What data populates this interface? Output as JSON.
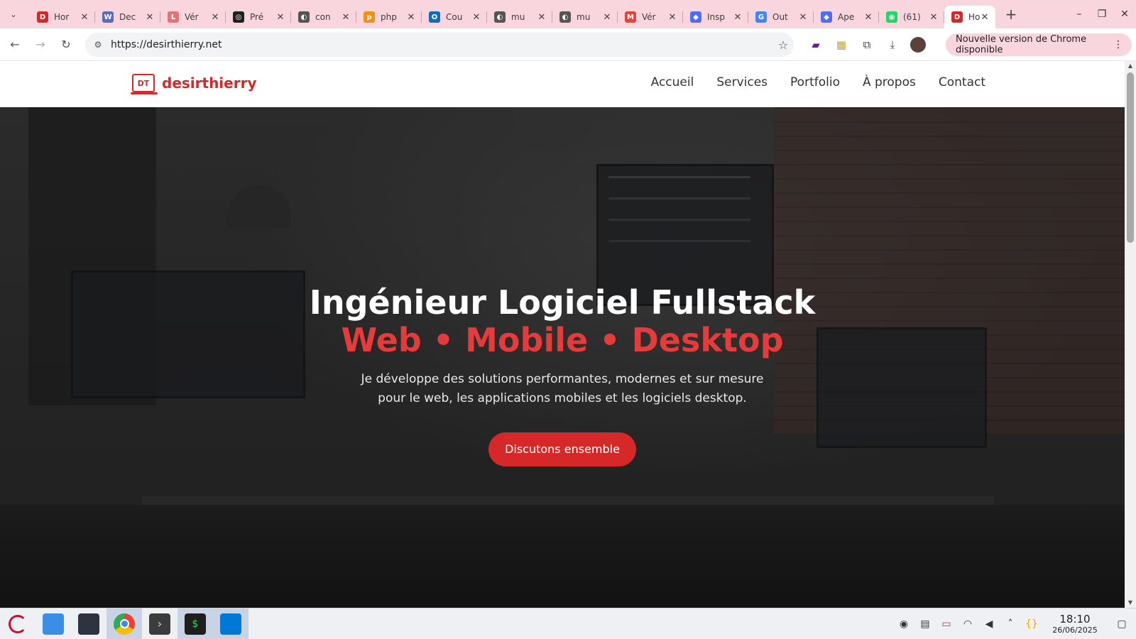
{
  "browser": {
    "tabs": [
      {
        "title": "Hor",
        "fav_color": "#d62828",
        "fav_char": "D"
      },
      {
        "title": "Dec",
        "fav_color": "#5c6bc0",
        "fav_char": "W"
      },
      {
        "title": "Vér",
        "fav_color": "#e57373",
        "fav_char": "L"
      },
      {
        "title": "Pré",
        "fav_color": "#202020",
        "fav_char": "◎"
      },
      {
        "title": "con",
        "fav_color": "#555555",
        "fav_char": "◐"
      },
      {
        "title": "php",
        "fav_color": "#f29111",
        "fav_char": "p"
      },
      {
        "title": "Cou",
        "fav_color": "#0f6cbd",
        "fav_char": "O"
      },
      {
        "title": "mu",
        "fav_color": "#555555",
        "fav_char": "◐"
      },
      {
        "title": "mu",
        "fav_color": "#555555",
        "fav_char": "◐"
      },
      {
        "title": "Vér",
        "fav_color": "#ea4335",
        "fav_char": "M"
      },
      {
        "title": "Insp",
        "fav_color": "#4e6ef2",
        "fav_char": "◆"
      },
      {
        "title": "Out",
        "fav_color": "#4285f4",
        "fav_char": "G"
      },
      {
        "title": "Ape",
        "fav_color": "#4e6ef2",
        "fav_char": "◆"
      },
      {
        "title": "(61)",
        "fav_color": "#25d366",
        "fav_char": "◉"
      },
      {
        "title": "Hor",
        "fav_color": "#d62828",
        "fav_char": "D",
        "active": true
      }
    ],
    "url": "https://desirthierry.net",
    "update_label": "Nouvelle version de Chrome disponible",
    "icons": {
      "back": "arrow-left",
      "forward": "arrow-right",
      "reload": "reload",
      "star": "star",
      "extensions": "puzzle",
      "download": "download"
    }
  },
  "site": {
    "logo_mark": "DT",
    "logo_text": "desirthierry",
    "nav": [
      "Accueil",
      "Services",
      "Portfolio",
      "À propos",
      "Contact"
    ],
    "hero": {
      "title": "Ingénieur Logiciel Fullstack",
      "subtitle": "Web • Mobile • Desktop",
      "description_line1": "Je développe des solutions performantes, modernes et sur mesure",
      "description_line2": "pour le web, les applications mobiles et les logiciels desktop.",
      "cta": "Discutons ensemble"
    },
    "colors": {
      "brand": "#d62828",
      "accent_text": "#e63b3b"
    }
  },
  "taskbar": {
    "time": "18:10",
    "date": "26/06/2025"
  }
}
